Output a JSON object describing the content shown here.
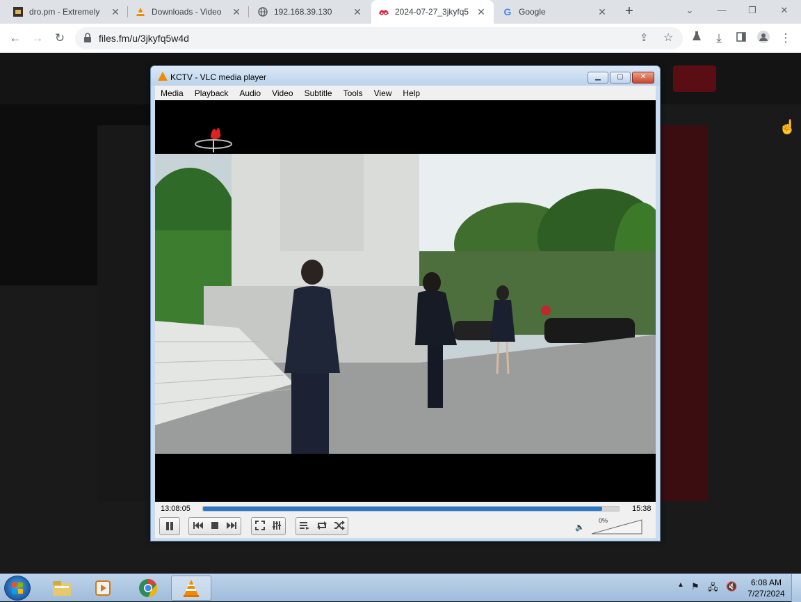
{
  "browser": {
    "tabs": [
      {
        "title": "dro.pm - Extremely",
        "icon": "dro-favicon"
      },
      {
        "title": "Downloads - Video",
        "icon": "vlc-favicon"
      },
      {
        "title": "192.168.39.130",
        "icon": "globe-icon"
      },
      {
        "title": "2024-07-27_3jkyfq5",
        "icon": "filesfm-favicon",
        "active": true
      },
      {
        "title": "Google",
        "icon": "google-icon"
      }
    ],
    "new_tab": "+",
    "window_controls": [
      "minimize",
      "restore",
      "close"
    ],
    "url": "files.fm/u/3jkyfq5w4d"
  },
  "vlc": {
    "title": "KCTV - VLC media player",
    "menu": [
      "Media",
      "Playback",
      "Audio",
      "Video",
      "Subtitle",
      "Tools",
      "View",
      "Help"
    ],
    "elapsed": "13:08:05",
    "total": "15:38",
    "progress": 0.96,
    "volume": "0%",
    "muted": true,
    "accent": "#2a78c8"
  },
  "taskbar": {
    "time": "6:08 AM",
    "date": "7/27/2024",
    "apps": [
      "explorer",
      "media-player",
      "chrome",
      "vlc"
    ]
  }
}
